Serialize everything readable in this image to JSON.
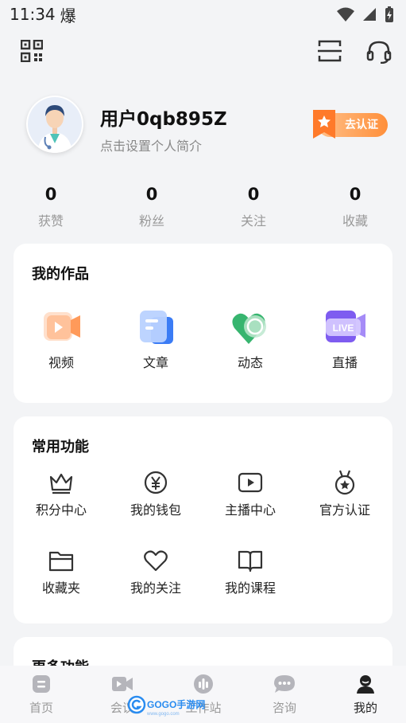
{
  "status_bar": {
    "time": "11:34",
    "extra": "爆"
  },
  "profile": {
    "username": "用户0qb895Z",
    "bio_placeholder": "点击设置个人简介",
    "certify_label": "去认证"
  },
  "stats": [
    {
      "value": "0",
      "label": "获赞"
    },
    {
      "value": "0",
      "label": "粉丝"
    },
    {
      "value": "0",
      "label": "关注"
    },
    {
      "value": "0",
      "label": "收藏"
    }
  ],
  "works": {
    "title": "我的作品",
    "items": [
      {
        "label": "视频",
        "icon": "video-icon"
      },
      {
        "label": "文章",
        "icon": "article-icon"
      },
      {
        "label": "动态",
        "icon": "moments-icon"
      },
      {
        "label": "直播",
        "icon": "live-icon",
        "badge": "LIVE"
      }
    ]
  },
  "common": {
    "title": "常用功能",
    "items": [
      {
        "label": "积分中心",
        "icon": "crown-icon"
      },
      {
        "label": "我的钱包",
        "icon": "yuan-icon"
      },
      {
        "label": "主播中心",
        "icon": "play-icon"
      },
      {
        "label": "官方认证",
        "icon": "medal-icon"
      },
      {
        "label": "收藏夹",
        "icon": "folder-icon"
      },
      {
        "label": "我的关注",
        "icon": "heart-icon"
      },
      {
        "label": "我的课程",
        "icon": "book-icon"
      }
    ]
  },
  "more": {
    "title": "更多功能"
  },
  "tabbar": [
    {
      "label": "首页",
      "icon": "home-icon"
    },
    {
      "label": "会议",
      "icon": "meeting-icon"
    },
    {
      "label": "工作站",
      "icon": "workstation-icon"
    },
    {
      "label": "咨询",
      "icon": "chat-icon"
    },
    {
      "label": "我的",
      "icon": "profile-icon",
      "active": true
    }
  ],
  "watermark": {
    "text": "GOGO手游网",
    "sub": "www.gogo.com"
  },
  "colors": {
    "accent": "#ff8f3a",
    "active_tab": "#222222",
    "inactive_tab": "#999999"
  }
}
